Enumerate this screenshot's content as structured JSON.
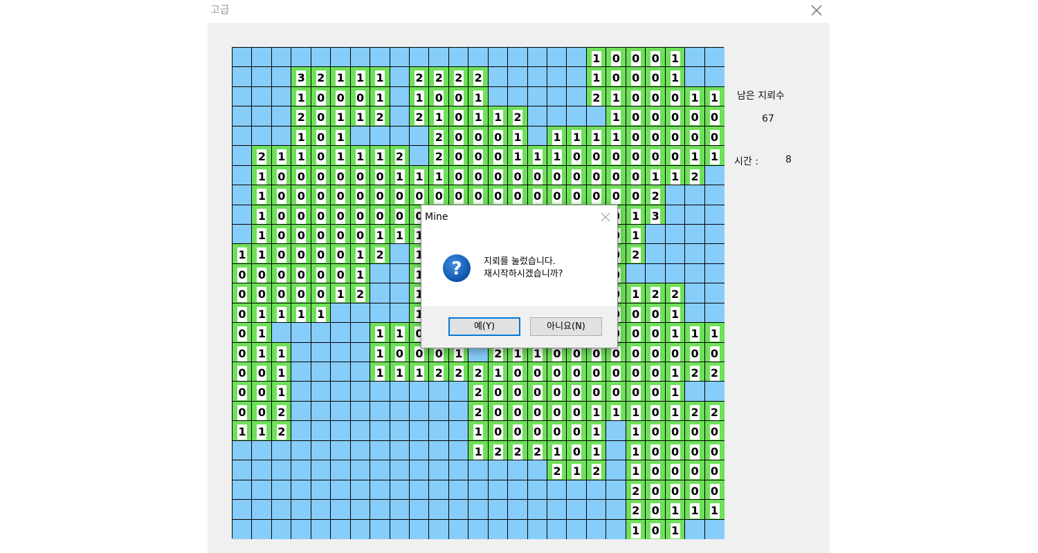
{
  "window": {
    "title": "고급",
    "close_icon": "close-icon"
  },
  "info": {
    "remaining_label": "남은 지뢰수",
    "remaining_value": "67",
    "time_label": "시간 :",
    "time_value": "8"
  },
  "board": {
    "size": 25,
    "colors": {
      "hidden": "#87cdfa",
      "open": "#6fe05a",
      "grid": "#000000"
    },
    "rows": [
      [
        "",
        "",
        "",
        "",
        "",
        "",
        "",
        "",
        "",
        "",
        "",
        "",
        "",
        "",
        "",
        "",
        "",
        "",
        "1",
        "0",
        "0",
        "0",
        "1",
        "",
        ""
      ],
      [
        "",
        "",
        "",
        "3",
        "2",
        "1",
        "1",
        "1",
        "",
        "2",
        "2",
        "2",
        "2",
        "",
        "",
        "",
        "",
        "",
        "1",
        "0",
        "0",
        "0",
        "1",
        "",
        ""
      ],
      [
        "",
        "",
        "",
        "1",
        "0",
        "0",
        "0",
        "1",
        "",
        "1",
        "0",
        "0",
        "1",
        "",
        "",
        "",
        "",
        "",
        "2",
        "1",
        "0",
        "0",
        "0",
        "1",
        "1"
      ],
      [
        "",
        "",
        "",
        "2",
        "0",
        "1",
        "1",
        "2",
        "",
        "2",
        "1",
        "0",
        "1",
        "1",
        "2",
        "",
        "",
        "",
        "",
        "1",
        "0",
        "0",
        "0",
        "0",
        "0"
      ],
      [
        "",
        "",
        "",
        "1",
        "0",
        "1",
        "",
        "",
        "",
        "",
        "2",
        "0",
        "0",
        "0",
        "1",
        "",
        "1",
        "1",
        "1",
        "1",
        "0",
        "0",
        "0",
        "0",
        "0"
      ],
      [
        "",
        "2",
        "1",
        "1",
        "0",
        "1",
        "1",
        "1",
        "2",
        "",
        "2",
        "0",
        "0",
        "0",
        "1",
        "1",
        "1",
        "0",
        "0",
        "0",
        "0",
        "0",
        "0",
        "1",
        "1"
      ],
      [
        "",
        "1",
        "0",
        "0",
        "0",
        "0",
        "0",
        "0",
        "1",
        "1",
        "1",
        "0",
        "0",
        "0",
        "0",
        "0",
        "0",
        "0",
        "0",
        "0",
        "0",
        "1",
        "1",
        "2",
        ""
      ],
      [
        "",
        "1",
        "0",
        "0",
        "0",
        "0",
        "0",
        "0",
        "0",
        "0",
        "0",
        "0",
        "0",
        "0",
        "0",
        "0",
        "0",
        "0",
        "0",
        "0",
        "0",
        "2",
        "",
        "",
        ""
      ],
      [
        "",
        "1",
        "0",
        "0",
        "0",
        "0",
        "0",
        "0",
        "0",
        "0",
        "0",
        "0",
        "0",
        "0",
        "0",
        "0",
        "0",
        "0",
        "0",
        "0",
        "1",
        "3",
        "",
        "",
        ""
      ],
      [
        "",
        "1",
        "0",
        "0",
        "0",
        "0",
        "0",
        "1",
        "1",
        "1",
        "0",
        "0",
        "0",
        "0",
        "0",
        "0",
        "0",
        "0",
        "0",
        "0",
        "1",
        "",
        "",
        "",
        ""
      ],
      [
        "1",
        "1",
        "0",
        "0",
        "0",
        "0",
        "1",
        "2",
        "",
        "1",
        "0",
        "0",
        "0",
        "0",
        "0",
        "0",
        "0",
        "0",
        "0",
        "0",
        "2",
        "",
        "",
        "",
        ""
      ],
      [
        "0",
        "0",
        "0",
        "0",
        "0",
        "0",
        "1",
        "",
        "",
        "1",
        "0",
        "0",
        "0",
        "0",
        "0",
        "0",
        "0",
        "0",
        "0",
        "0",
        "",
        "",
        "",
        "",
        ""
      ],
      [
        "0",
        "0",
        "0",
        "0",
        "0",
        "1",
        "2",
        "",
        "",
        "1",
        "0",
        "0",
        "0",
        "0",
        "0",
        "0",
        "0",
        "0",
        "0",
        "0",
        "1",
        "2",
        "2",
        "",
        ""
      ],
      [
        "0",
        "1",
        "1",
        "1",
        "1",
        "",
        "",
        "",
        "",
        "1",
        "0",
        "0",
        "0",
        "0",
        "0",
        "0",
        "0",
        "0",
        "0",
        "0",
        "0",
        "0",
        "1",
        "",
        ""
      ],
      [
        "0",
        "1",
        "",
        "",
        "",
        "",
        "",
        "1",
        "1",
        "0",
        "0",
        "0",
        "0",
        "0",
        "0",
        "0",
        "0",
        "0",
        "0",
        "0",
        "0",
        "0",
        "1",
        "1",
        "1"
      ],
      [
        "0",
        "1",
        "1",
        "",
        "",
        "",
        "",
        "1",
        "0",
        "0",
        "0",
        "1",
        "",
        "2",
        "1",
        "1",
        "0",
        "0",
        "0",
        "0",
        "0",
        "0",
        "0",
        "0",
        "0"
      ],
      [
        "0",
        "0",
        "1",
        "",
        "",
        "",
        "",
        "1",
        "1",
        "1",
        "2",
        "2",
        "2",
        "1",
        "0",
        "0",
        "0",
        "0",
        "0",
        "0",
        "0",
        "0",
        "1",
        "2",
        "2"
      ],
      [
        "0",
        "0",
        "1",
        "",
        "",
        "",
        "",
        "",
        "",
        "",
        "",
        "",
        "2",
        "0",
        "0",
        "0",
        "0",
        "0",
        "0",
        "0",
        "0",
        "0",
        "1",
        "",
        ""
      ],
      [
        "0",
        "0",
        "2",
        "",
        "",
        "",
        "",
        "",
        "",
        "",
        "",
        "",
        "2",
        "0",
        "0",
        "0",
        "0",
        "0",
        "1",
        "1",
        "1",
        "0",
        "1",
        "2",
        "2"
      ],
      [
        "1",
        "1",
        "2",
        "",
        "",
        "",
        "",
        "",
        "",
        "",
        "",
        "",
        "1",
        "0",
        "0",
        "0",
        "0",
        "0",
        "1",
        "",
        "1",
        "0",
        "0",
        "0",
        "0"
      ],
      [
        "",
        "",
        "",
        "",
        "",
        "",
        "",
        "",
        "",
        "",
        "",
        "",
        "1",
        "2",
        "2",
        "2",
        "1",
        "0",
        "1",
        "",
        "1",
        "0",
        "0",
        "0",
        "0"
      ],
      [
        "",
        "",
        "",
        "",
        "",
        "",
        "",
        "",
        "",
        "",
        "",
        "",
        "",
        "",
        "",
        "",
        "2",
        "1",
        "2",
        "",
        "1",
        "0",
        "0",
        "0",
        "0"
      ],
      [
        "",
        "",
        "",
        "",
        "",
        "",
        "",
        "",
        "",
        "",
        "",
        "",
        "",
        "",
        "",
        "",
        "",
        "",
        "",
        "",
        "2",
        "0",
        "0",
        "0",
        "0"
      ],
      [
        "",
        "",
        "",
        "",
        "",
        "",
        "",
        "",
        "",
        "",
        "",
        "",
        "",
        "",
        "",
        "",
        "",
        "",
        "",
        "",
        "2",
        "0",
        "1",
        "1",
        "1"
      ],
      [
        "",
        "",
        "",
        "",
        "",
        "",
        "",
        "",
        "",
        "",
        "",
        "",
        "",
        "",
        "",
        "",
        "",
        "",
        "",
        "",
        "1",
        "0",
        "1",
        "",
        ""
      ]
    ]
  },
  "dialog": {
    "title": "Mine",
    "icon": "question-icon",
    "message_line1": "지뢰를 눌렀습니다.",
    "message_line2": "재시작하시겠습니까?",
    "yes_label": "예(Y)",
    "no_label": "아니요(N)"
  }
}
